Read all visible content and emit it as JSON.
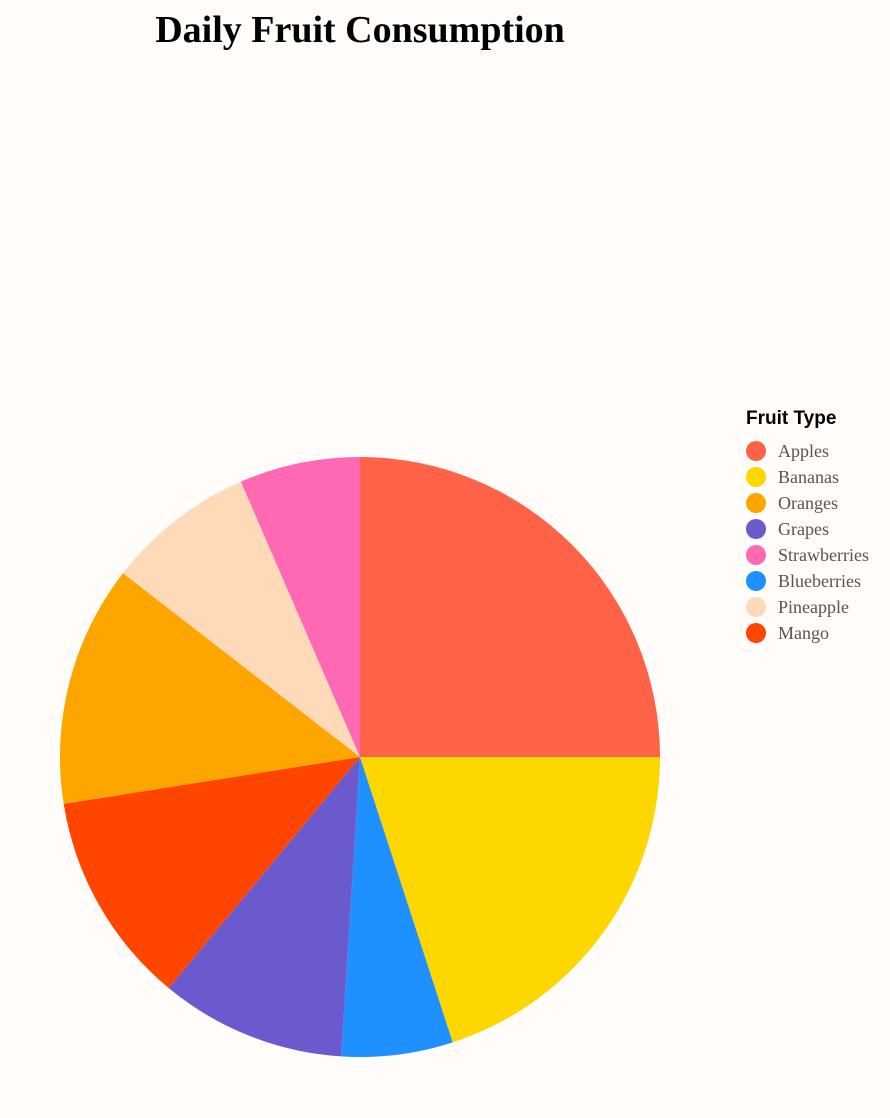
{
  "chart_data": {
    "type": "pie",
    "title": "Daily Fruit Consumption",
    "legend": {
      "title": "Fruit Type",
      "placement": "right"
    },
    "categories": [
      "Apples",
      "Bananas",
      "Oranges",
      "Grapes",
      "Strawberries",
      "Blueberries",
      "Pineapple",
      "Mango"
    ],
    "values": [
      25,
      20,
      13,
      10,
      6.5,
      6,
      8,
      11.5
    ],
    "draw_order": [
      "Apples",
      "Bananas",
      "Blueberries",
      "Grapes",
      "Mango",
      "Oranges",
      "Pineapple",
      "Strawberries"
    ],
    "colors": {
      "Apples": "#FF6347",
      "Bananas": "#FFD700",
      "Oranges": "#FFA500",
      "Grapes": "#6A5ACD",
      "Strawberries": "#FF69B4",
      "Blueberries": "#1E90FF",
      "Pineapple": "#FFDAB9",
      "Mango": "#FF4500"
    }
  },
  "colors": {
    "background": "#FFFCF9"
  }
}
